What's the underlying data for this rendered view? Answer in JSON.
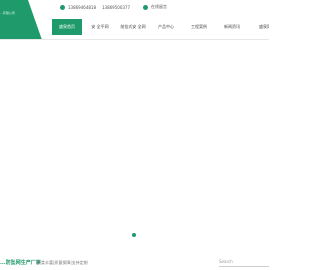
{
  "header": {
    "logo_caption": "...有限公司",
    "phone_1": "13869464818",
    "phone_2": "13869500377",
    "online_label": "在线留言"
  },
  "nav": {
    "items": [
      {
        "label": "盛泉首页"
      },
      {
        "label": "安 全平网"
      },
      {
        "label": "前挂式安 全网"
      },
      {
        "label": "产品中心"
      },
      {
        "label": "工程案例"
      },
      {
        "label": "新闻资讯"
      },
      {
        "label": "盛泉简"
      }
    ]
  },
  "footer": {
    "title": "...防坠网生产厂家",
    "subtitle": "种类丰富|质量保障|支持定制",
    "search_label": "Search"
  },
  "colors": {
    "brand": "#1f9a6a"
  }
}
